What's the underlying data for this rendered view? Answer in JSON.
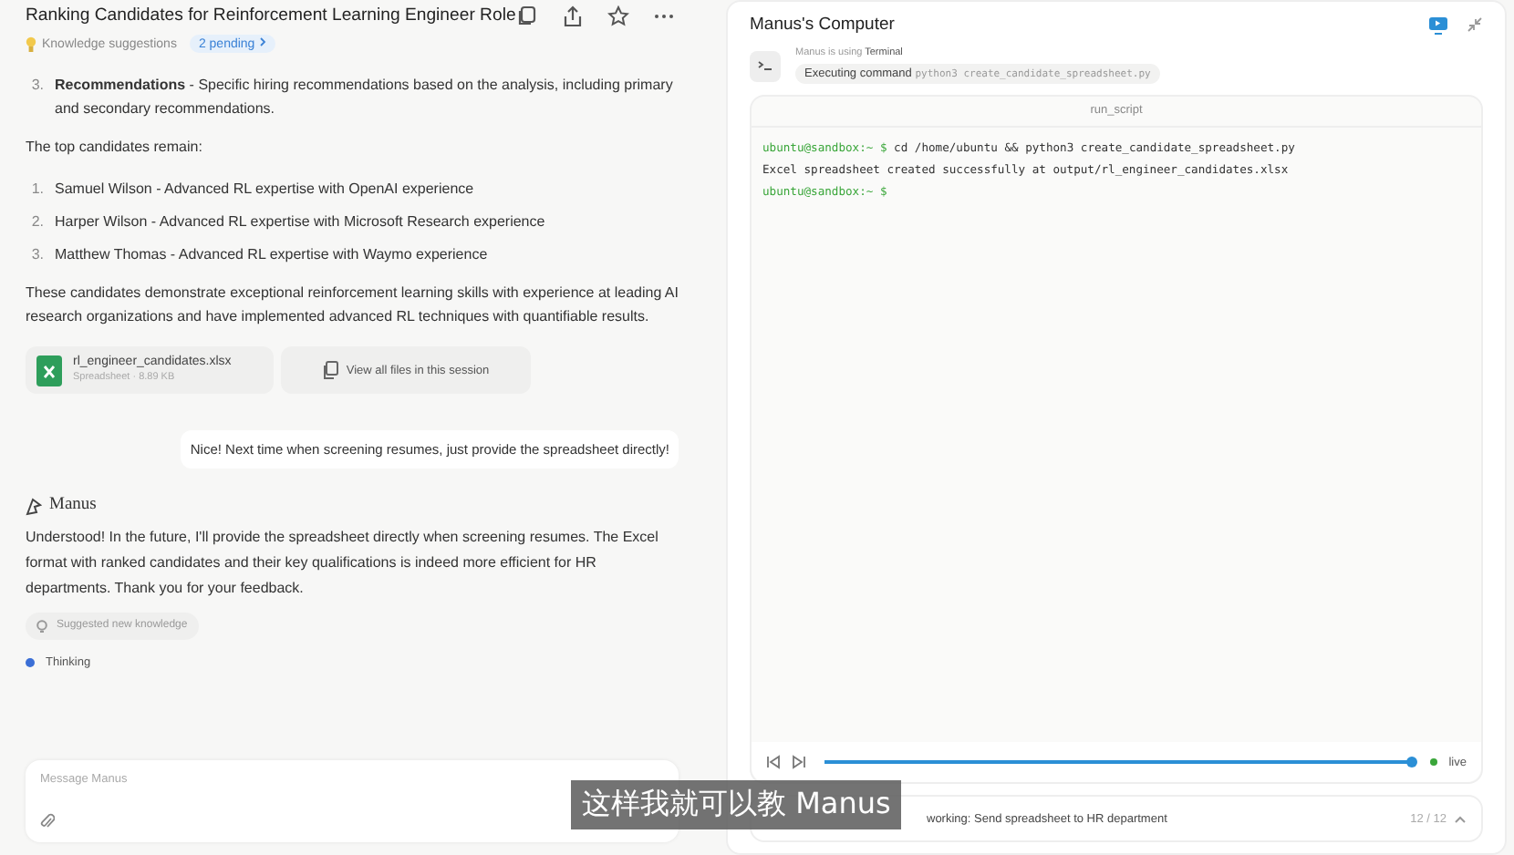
{
  "chat": {
    "title": "Ranking Candidates for Reinforcement Learning Engineer Role",
    "knowledge": {
      "label": "Knowledge suggestions",
      "badge": "2 pending"
    },
    "recommendation": {
      "number": "3.",
      "text": "**Recommendations** - Specific hiring recommendations based on the analysis, including primary and secondary recommendations."
    },
    "intro": "The top candidates remain:",
    "candidates": [
      {
        "number": "1.",
        "text": "Samuel Wilson - Advanced RL expertise with OpenAI experience"
      },
      {
        "number": "2.",
        "text": "Harper Wilson - Advanced RL expertise with Microsoft Research experience"
      },
      {
        "number": "3.",
        "text": "Matthew Thomas - Advanced RL expertise with Waymo experience"
      }
    ],
    "summary": "These candidates demonstrate exceptional reinforcement learning skills with experience at leading AI research organizations and have implemented advanced RL techniques with quantifiable results.",
    "file": {
      "name": "rl_engineer_candidates.xlsx",
      "meta": "Spreadsheet · 8.89 KB"
    },
    "view_all": "View all files in this session",
    "user_message": "Nice! Next time when screening resumes, just provide the spreadsheet directly!",
    "agent_name": "Manus",
    "reply": "Understood! In the future, I'll provide the spreadsheet directly when screening resumes. The Excel format with ranked candidates and their key qualifications is indeed more efficient for HR departments. Thank you for your feedback.",
    "suggested": "Suggested new knowledge",
    "thinking": "Thinking",
    "input": {
      "placeholder": "Message Manus"
    }
  },
  "computer": {
    "title": "Manus's Computer",
    "using": {
      "prefix": "Manus is using",
      "tool": "Terminal"
    },
    "command": {
      "label": "Executing command",
      "value": "python3 create_candidate_spreadsheet.py"
    },
    "terminal": {
      "title": "run_script",
      "lines": [
        {
          "prompt": "ubuntu@sandbox:~ $",
          "text": "cd /home/ubuntu && python3 create_candidate_spreadsheet.py"
        },
        {
          "text": "Excel spreadsheet created successfully at output/rl_engineer_candidates.xlsx"
        },
        {
          "prompt": "ubuntu@sandbox:~ $"
        }
      ]
    },
    "playback": {
      "level": 1,
      "live": "live"
    },
    "task": {
      "text": "working: Send spreadsheet to HR department",
      "count": "12 / 12"
    }
  },
  "caption": "这样我就可以教 Manus"
}
